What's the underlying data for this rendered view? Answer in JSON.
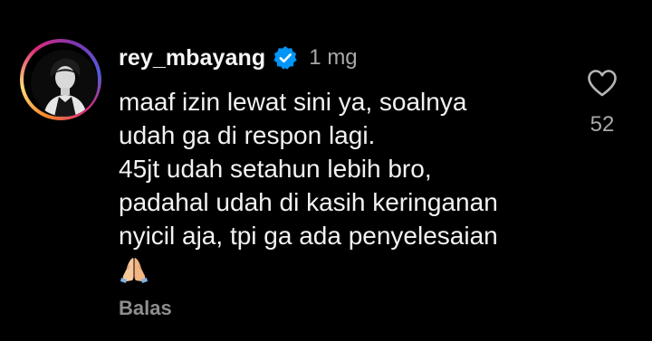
{
  "comment": {
    "username": "rey_mbayang",
    "verified": true,
    "timestamp": "1 mg",
    "lines": [
      "maaf izin lewat sini ya, soalnya",
      "udah ga di respon lagi.",
      "45jt udah setahun lebih bro,",
      "padahal udah di kasih keringanan",
      "nyicil aja, tpi ga ada penyelesaian"
    ],
    "emoji": "folded-hands-emoji",
    "reply_label": "Balas",
    "like_count": "52"
  },
  "colors": {
    "background": "#000000",
    "text": "#f2f2f2",
    "muted": "#a8a8a8",
    "verified_blue": "#0095f6"
  },
  "icons": {
    "verified": "verified-badge-icon",
    "like": "heart-outline-icon"
  }
}
